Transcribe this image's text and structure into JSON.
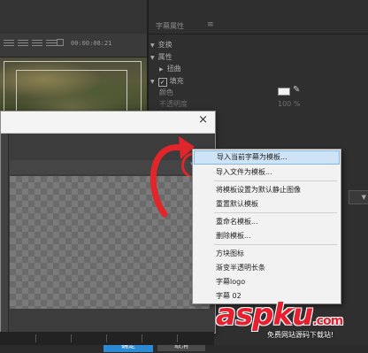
{
  "editor": {
    "timecode": "00:00:08:21"
  },
  "props_panel": {
    "title": "字幕属性",
    "menu_icon": "≡",
    "rows": {
      "transform": "变换",
      "properties": "属性",
      "distort": "扭曲",
      "fill": "填充",
      "color": "颜色",
      "opacity": "不透明度"
    },
    "fill_checked": "✓",
    "opacity_value": "100 %",
    "swatch_color": "#f2f2f2"
  },
  "dialog": {
    "close_icon": "×",
    "flyout_icon": "▾≡",
    "ok_label": "确定",
    "cancel_label": "取消"
  },
  "context_menu": {
    "items": [
      "导入当前字幕为模板...",
      "导入文件为模板...",
      "将模板设置为默认静止图像",
      "重置默认模板",
      "重命名模板...",
      "删除模板...",
      "方块图标",
      "渐变半透明长条",
      "字幕logo",
      "字幕 02"
    ],
    "highlighted_index": 0
  },
  "watermark": {
    "logo": "aspku",
    "logo_suffix": ".com",
    "tagline": "免费网站源码下载站!"
  },
  "colors": {
    "accent_red": "#e0262a",
    "ok_button": "#2b8ad1",
    "menu_highlight": "#cfe3f7"
  }
}
